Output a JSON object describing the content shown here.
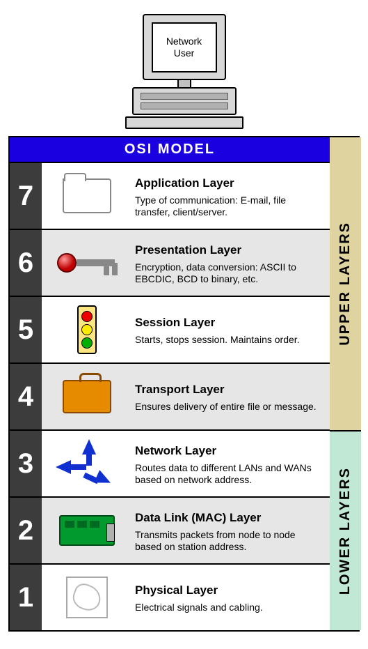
{
  "computer_label": "Network\nUser",
  "title": "OSI MODEL",
  "side": {
    "upper": "UPPER LAYERS",
    "lower": "LOWER LAYERS"
  },
  "layers": [
    {
      "num": "7",
      "name": "Application Layer",
      "desc": "Type of communication: E-mail, file transfer, client/server.",
      "icon": "folder-icon",
      "bg": "bg-white"
    },
    {
      "num": "6",
      "name": "Presentation Layer",
      "desc": "Encryption, data conversion: ASCII to EBCDIC, BCD to binary, etc.",
      "icon": "key-icon",
      "bg": "bg-grey"
    },
    {
      "num": "5",
      "name": "Session Layer",
      "desc": "Starts, stops session. Maintains order.",
      "icon": "traffic-light-icon",
      "bg": "bg-white"
    },
    {
      "num": "4",
      "name": "Transport Layer",
      "desc": "Ensures delivery of entire file or message.",
      "icon": "suitcase-icon",
      "bg": "bg-grey"
    },
    {
      "num": "3",
      "name": "Network Layer",
      "desc": "Routes data to different LANs and WANs based on network address.",
      "icon": "routing-arrows-icon",
      "bg": "bg-white"
    },
    {
      "num": "2",
      "name": "Data Link (MAC) Layer",
      "desc": "Transmits packets from node to node based on station address.",
      "icon": "network-card-icon",
      "bg": "bg-grey"
    },
    {
      "num": "1",
      "name": "Physical Layer",
      "desc": "Electrical signals and cabling.",
      "icon": "cable-icon",
      "bg": "bg-white"
    }
  ]
}
